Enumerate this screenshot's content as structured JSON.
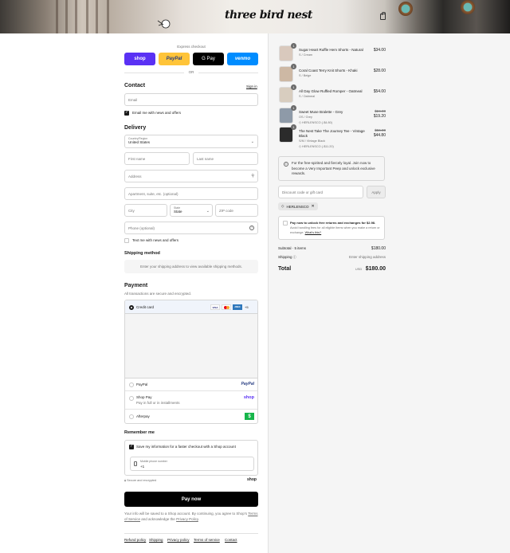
{
  "header": {
    "logo": "three bird nest"
  },
  "express": {
    "title": "Express checkout",
    "shop_pay": "shop",
    "paypal": "PayPal",
    "gpay": "G Pay",
    "venmo": "venmo",
    "or": "OR"
  },
  "contact": {
    "title": "Contact",
    "sign_in": "Sign in",
    "email_placeholder": "Email",
    "email_news": "Email me with news and offers"
  },
  "delivery": {
    "title": "Delivery",
    "country_label": "Country/Region",
    "country_value": "United States",
    "first_name": "First name",
    "last_name": "Last name",
    "address": "Address",
    "apartment": "Apartment, suite, etc. (optional)",
    "city": "City",
    "state_label": "State",
    "state_value": "State",
    "zip": "ZIP code",
    "phone": "Phone (optional)",
    "text_news": "Text me with news and offers"
  },
  "shipping": {
    "title": "Shipping method",
    "placeholder": "Enter your shipping address to view available shipping methods."
  },
  "payment": {
    "title": "Payment",
    "subtitle": "All transactions are secure and encrypted.",
    "credit_card": "Credit card",
    "paypal": "PayPal",
    "paypal_logo": "PayPal",
    "shop_pay": "Shop Pay",
    "shop_pay_sub": "Pay in full or in installments",
    "shop_logo": "shop",
    "afterpay": "Afterpay",
    "afterpay_logo": "$",
    "card_brands": [
      "VISA",
      "",
      "AMEX",
      "+5"
    ]
  },
  "remember": {
    "title": "Remember me",
    "save_info": "Save my information for a faster checkout with a Shop account",
    "mobile_label": "Mobile phone number",
    "mobile_value": "+1",
    "secure": "Secure and encrypted",
    "shop_logo": "shop"
  },
  "pay_now": "Pay now",
  "legal": {
    "line1": "Your info will be saved to a Shop account. By continuing, you agree to Shop's",
    "terms": "Terms of Service",
    "and_ack": "and acknowledge the",
    "privacy": "Privacy Policy",
    "period": "."
  },
  "footer_links": [
    "Refund policy",
    "Shipping",
    "Privacy policy",
    "Terms of service",
    "Contact"
  ],
  "cart": {
    "items": [
      {
        "name": "Sugar Heart Ruffle Hem Shorts - Natural",
        "variant": "S / Cream",
        "price": "$34.00",
        "qty": "1",
        "discount": "",
        "compare": "",
        "color": "#d9c9bd"
      },
      {
        "name": "Coral Coast Terry Knit Shorts - Khaki",
        "variant": "S / Beige",
        "price": "$28.00",
        "qty": "1",
        "discount": "",
        "compare": "",
        "color": "#cdb8a4"
      },
      {
        "name": "All Day Glow Ruffled Romper - Oatmeal",
        "variant": "S / Oatmeal",
        "price": "$54.00",
        "qty": "1",
        "discount": "",
        "compare": "",
        "color": "#d8cdbf"
      },
      {
        "name": "Sweet Muse Bralette - Grey",
        "variant": "OS / Grey",
        "price": "$19.20",
        "qty": "1",
        "discount": "HERLENSCO (-$4.80)",
        "compare": "$24.00",
        "color": "#8e9aa8"
      },
      {
        "name": "The Nest Take The Journey Tee - Vintage Black",
        "variant": "S/M / Vintage Black",
        "price": "$44.80",
        "qty": "1",
        "discount": "HERLENSCO (-$11.20)",
        "compare": "$56.00",
        "color": "#2b2b2b"
      }
    ],
    "vip_text": "For the free-spirited and fiercely loyal. Join now to become a Very Important Peep and unlock exclusive rewards.",
    "discount_placeholder": "Discount code or gift card",
    "apply": "Apply",
    "applied_code": "HERLENSCO",
    "returns_title": "Pay now to unlock free returns and exchanges for $2.98.",
    "returns_body": "Avoid handling fees for all eligible items when you make a return or exchange.",
    "whats_this": "What's this?",
    "subtotal_label": "Subtotal · 5 items",
    "subtotal_value": "$180.00",
    "shipping_label": "Shipping",
    "shipping_value": "Enter shipping address",
    "total_label": "Total",
    "currency": "USD",
    "total_value": "$180.00"
  }
}
